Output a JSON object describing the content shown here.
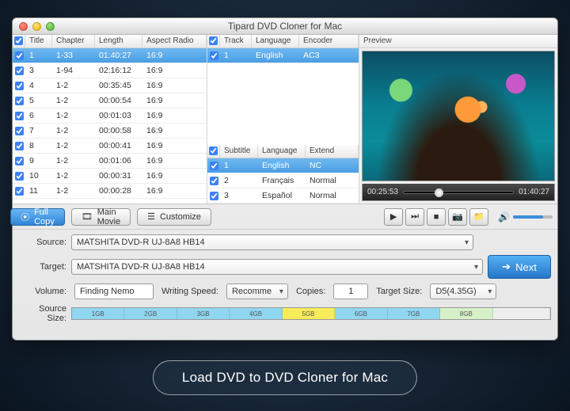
{
  "window": {
    "title": "Tipard DVD Cloner for Mac"
  },
  "titles": {
    "headers": {
      "check": "",
      "title": "Title",
      "chapter": "Chapter",
      "length": "Length",
      "aspect": "Aspect Radio"
    },
    "rows": [
      {
        "n": "1",
        "chapter": "1-33",
        "length": "01:40:27",
        "aspect": "16:9",
        "sel": true
      },
      {
        "n": "3",
        "chapter": "1-94",
        "length": "02:16:12",
        "aspect": "16:9",
        "sel": false
      },
      {
        "n": "4",
        "chapter": "1-2",
        "length": "00:35:45",
        "aspect": "16:9",
        "sel": false
      },
      {
        "n": "5",
        "chapter": "1-2",
        "length": "00:00:54",
        "aspect": "16:9",
        "sel": false
      },
      {
        "n": "6",
        "chapter": "1-2",
        "length": "00:01:03",
        "aspect": "16:9",
        "sel": false
      },
      {
        "n": "7",
        "chapter": "1-2",
        "length": "00:00:58",
        "aspect": "16:9",
        "sel": false
      },
      {
        "n": "8",
        "chapter": "1-2",
        "length": "00:00:41",
        "aspect": "16:9",
        "sel": false
      },
      {
        "n": "9",
        "chapter": "1-2",
        "length": "00:01:06",
        "aspect": "16:9",
        "sel": false
      },
      {
        "n": "10",
        "chapter": "1-2",
        "length": "00:00:31",
        "aspect": "16:9",
        "sel": false
      },
      {
        "n": "11",
        "chapter": "1-2",
        "length": "00:00:28",
        "aspect": "16:9",
        "sel": false
      }
    ]
  },
  "tracks": {
    "headers": {
      "check": "",
      "track": "Track",
      "language": "Language",
      "encoder": "Encoder"
    },
    "rows": [
      {
        "n": "1",
        "language": "English",
        "encoder": "AC3",
        "sel": true
      }
    ]
  },
  "subtitles": {
    "headers": {
      "check": "",
      "subtitle": "Subtitle",
      "language": "Language",
      "extend": "Extend"
    },
    "rows": [
      {
        "n": "1",
        "language": "English",
        "extend": "NC",
        "sel": true
      },
      {
        "n": "2",
        "language": "Français",
        "extend": "Normal",
        "sel": false
      },
      {
        "n": "3",
        "language": "Español",
        "extend": "Normal",
        "sel": false
      }
    ]
  },
  "preview": {
    "label": "Preview",
    "position": "00:25:53",
    "duration": "01:40:27"
  },
  "modes": {
    "full": "Full Copy",
    "main": "Main Movie",
    "custom": "Customize"
  },
  "form": {
    "source_label": "Source:",
    "source_value": "MATSHITA DVD-R   UJ-8A8 HB14",
    "target_label": "Target:",
    "target_value": "MATSHITA DVD-R   UJ-8A8 HB14",
    "volume_label": "Volume:",
    "volume_value": "Finding Nemo",
    "speed_label": "Writing Speed:",
    "speed_value": "Recomme",
    "copies_label": "Copies:",
    "copies_value": "1",
    "tsize_label": "Target Size:",
    "tsize_value": "D5(4.35G)",
    "ssize_label": "Source Size:",
    "next": "Next"
  },
  "gauge": {
    "segments": [
      {
        "label": "1GB",
        "color": "#8fd6f0",
        "w": 11
      },
      {
        "label": "2GB",
        "color": "#8fd6f0",
        "w": 11
      },
      {
        "label": "3GB",
        "color": "#8fd6f0",
        "w": 11
      },
      {
        "label": "4GB",
        "color": "#8fd6f0",
        "w": 11
      },
      {
        "label": "5GB",
        "color": "#f7ec5a",
        "w": 11
      },
      {
        "label": "6GB",
        "color": "#8fd6f0",
        "w": 11
      },
      {
        "label": "7GB",
        "color": "#8fd6f0",
        "w": 11
      },
      {
        "label": "8GB",
        "color": "#d6f0c8",
        "w": 11
      },
      {
        "label": "",
        "color": "#eeeeee",
        "w": 12
      }
    ]
  },
  "caption": "Load DVD to DVD Cloner for Mac"
}
